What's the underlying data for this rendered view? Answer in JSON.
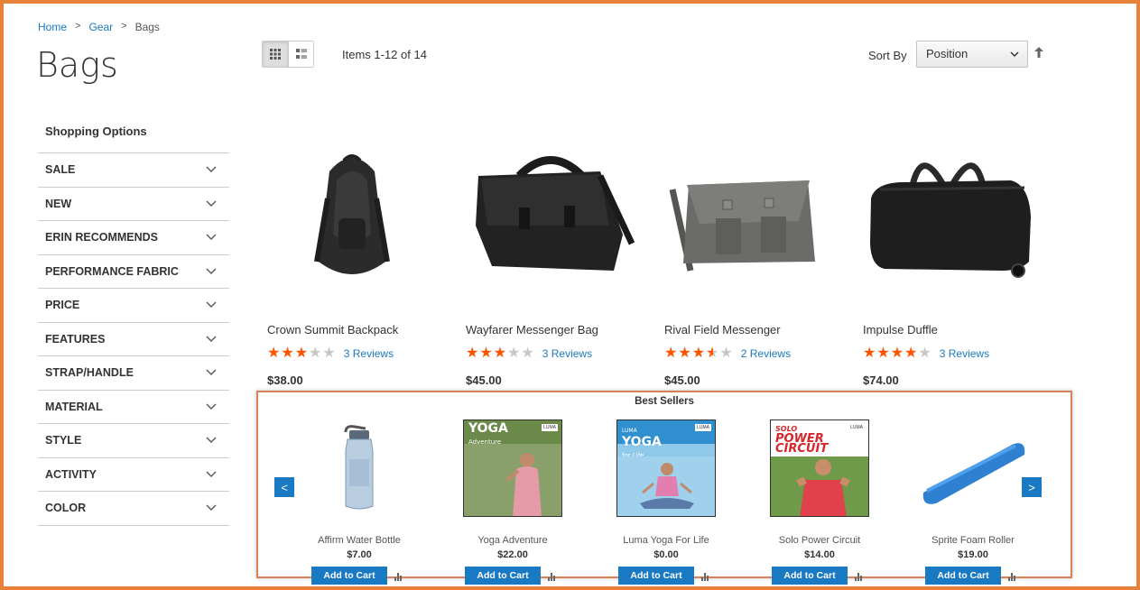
{
  "breadcrumb": {
    "home": "Home",
    "sep": ">",
    "gear": "Gear",
    "current": "Bags"
  },
  "page": {
    "title": "Bags"
  },
  "toolbar": {
    "amount": "Items 1-12 of 14",
    "sort_label": "Sort By",
    "sort_value": "Position",
    "view_modes": [
      "grid",
      "list"
    ],
    "active_mode": "grid"
  },
  "sidebar": {
    "title": "Shopping Options",
    "filters": [
      "SALE",
      "NEW",
      "ERIN RECOMMENDS",
      "PERFORMANCE FABRIC",
      "PRICE",
      "FEATURES",
      "STRAP/HANDLE",
      "MATERIAL",
      "STYLE",
      "ACTIVITY",
      "COLOR"
    ]
  },
  "products": [
    {
      "name": "Crown Summit Backpack",
      "rating": 0.6,
      "reviews": "3 Reviews",
      "price": "$38.00",
      "image": "backpack"
    },
    {
      "name": "Wayfarer Messenger Bag",
      "rating": 0.6,
      "reviews": "3 Reviews",
      "price": "$45.00",
      "image": "messenger"
    },
    {
      "name": "Rival Field Messenger",
      "rating": 0.7,
      "reviews": "2 Reviews",
      "price": "$45.00",
      "image": "field-messenger"
    },
    {
      "name": "Impulse Duffle",
      "rating": 0.8,
      "reviews": "3 Reviews",
      "price": "$74.00",
      "image": "duffle"
    }
  ],
  "bestsellers": {
    "title": "Best Sellers",
    "prev": "<",
    "next": ">",
    "items": [
      {
        "name": "Affirm Water Bottle",
        "price": "$7.00",
        "cart": "Add to Cart",
        "image": "water-bottle"
      },
      {
        "name": "Yoga Adventure",
        "price": "$22.00",
        "cart": "Add to Cart",
        "image": "yoga-adventure-dvd"
      },
      {
        "name": "Luma Yoga For Life",
        "price": "$0.00",
        "cart": "Add to Cart",
        "image": "luma-yoga-dvd"
      },
      {
        "name": "Solo Power Circuit",
        "price": "$14.00",
        "cart": "Add to Cart",
        "image": "solo-power-dvd"
      },
      {
        "name": "Sprite Foam Roller",
        "price": "$19.00",
        "cart": "Add to Cart",
        "image": "foam-roller"
      }
    ],
    "dvd_labels": {
      "yoga_title": "YOGA",
      "yoga_sub": "Adventure",
      "luma_top": "LUMA",
      "luma_title": "YOGA",
      "luma_sub": "for Life",
      "solo_top": "SOLO",
      "solo_l1": "POWER",
      "solo_l2": "CIRCUIT",
      "logo": "LUMA"
    }
  },
  "colors": {
    "accent": "#1979c3",
    "star": "#ff5501",
    "frame": "#e8823a"
  }
}
